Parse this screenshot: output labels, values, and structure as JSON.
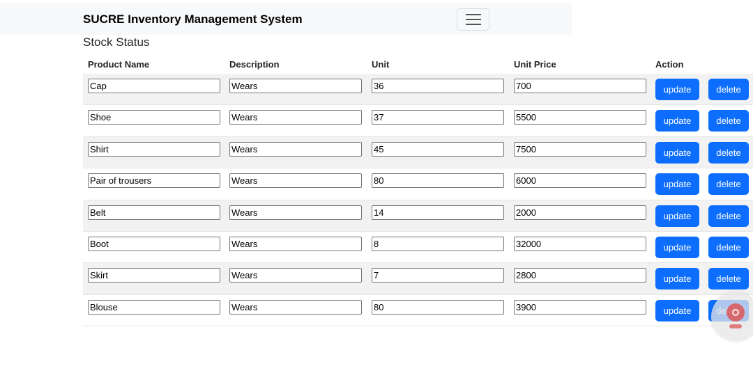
{
  "navbar": {
    "brand": "SUCRE Inventory Management System"
  },
  "section_title": "Stock Status",
  "table": {
    "headers": [
      "Product Name",
      "Description",
      "Unit",
      "Unit Price",
      "Action"
    ],
    "update_label": "update",
    "delete_label": "delete",
    "rows": [
      {
        "name": "Cap",
        "description": "Wears",
        "unit": "36",
        "price": "700"
      },
      {
        "name": "Shoe",
        "description": "Wears",
        "unit": "37",
        "price": "5500"
      },
      {
        "name": "Shirt",
        "description": "Wears",
        "unit": "45",
        "price": "7500"
      },
      {
        "name": "Pair of trousers",
        "description": "Wears",
        "unit": "80",
        "price": "6000"
      },
      {
        "name": "Belt",
        "description": "Wears",
        "unit": "14",
        "price": "2000"
      },
      {
        "name": "Boot",
        "description": "Wears",
        "unit": "8",
        "price": "32000"
      },
      {
        "name": "Skirt",
        "description": "Wears",
        "unit": "7",
        "price": "2800"
      },
      {
        "name": "Blouse",
        "description": "Wears",
        "unit": "80",
        "price": "3900"
      }
    ]
  },
  "colors": {
    "primary": "#0d6efd",
    "navbar_bg": "#f8f9fa",
    "stripe_bg": "#f2f2f2"
  },
  "icons": {
    "menu": "hamburger-menu-icon",
    "chat": "chat-assistant-icon"
  }
}
